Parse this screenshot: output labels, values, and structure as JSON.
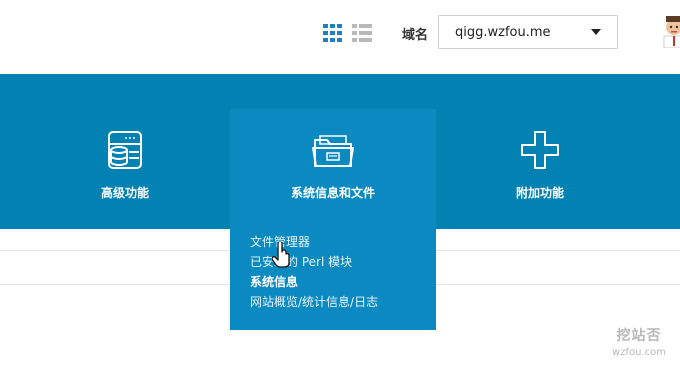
{
  "header": {
    "domain_label": "域名",
    "domain_value": "qigg.wzfou.me",
    "view_icons": [
      "grid-view-icon",
      "list-view-icon"
    ],
    "avatar_icon": "user-avatar-icon"
  },
  "nav": {
    "items": [
      {
        "label": "高级功能",
        "icon": "server-database-icon"
      },
      {
        "label": "系统信息和文件",
        "icon": "folder-icon"
      },
      {
        "label": "附加功能",
        "icon": "plus-icon"
      }
    ]
  },
  "dropdown": {
    "items": [
      {
        "label": "文件管理器"
      },
      {
        "label": "已安装的 Perl 模块"
      },
      {
        "label": "系统信息"
      },
      {
        "label": "网站概览/统计信息/日志"
      }
    ]
  },
  "watermark": {
    "line1": "挖站否",
    "line2": "wzfou.com"
  },
  "colors": {
    "band": "#0281b3",
    "dropdown": "#0a8ac1",
    "active_view": "#1f7fc0",
    "inactive_view": "#b9b9b9"
  }
}
